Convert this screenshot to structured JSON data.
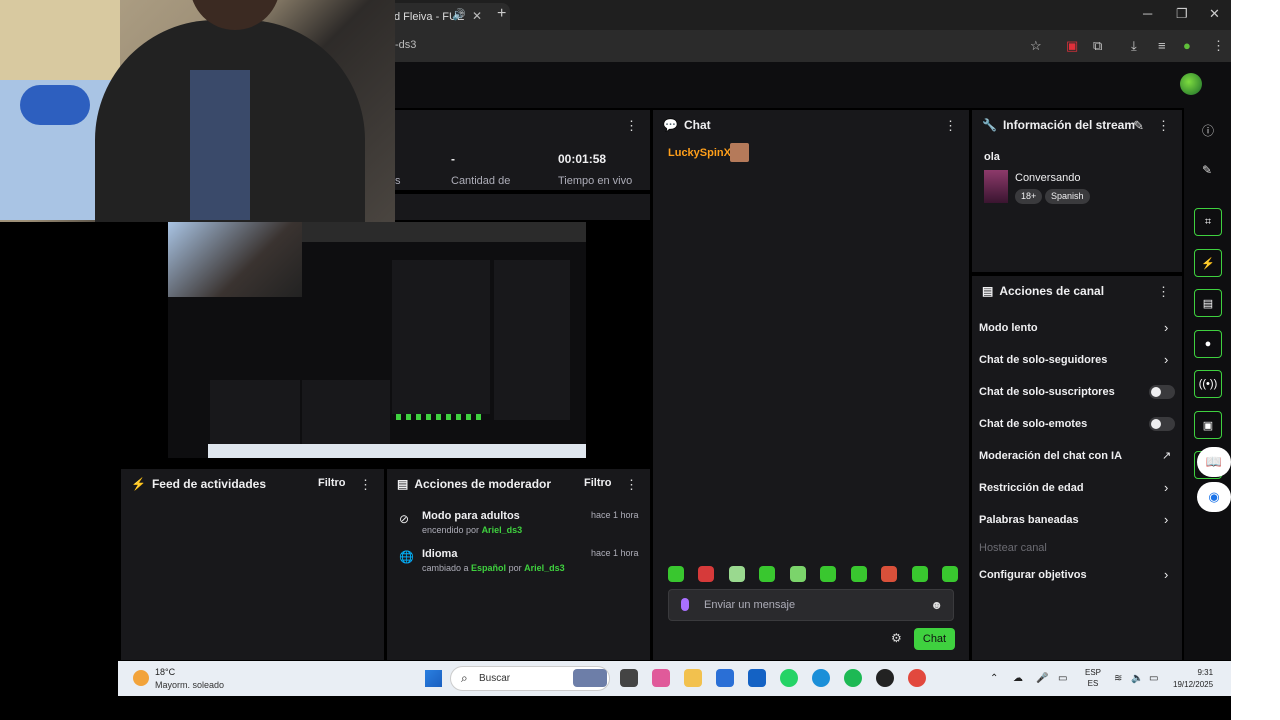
{
  "browser": {
    "tab_title": "d Fleiva - FUE",
    "url": "-ds3"
  },
  "stats": {
    "first_label_fragment": "s",
    "viewers_value": "-",
    "viewers_label": "Cantidad de",
    "uptime_value": "00:01:58",
    "uptime_label": "Tiempo en vivo"
  },
  "chat": {
    "title": "Chat",
    "message_user": "LuckySpinX:",
    "input_placeholder": "Enviar un mensaje",
    "send_label": "Chat",
    "accent_color": "#3fd13f",
    "username_color": "#ff9f1a"
  },
  "stream_info": {
    "title": "Información del stream",
    "stream_title": "ola",
    "category": "Conversando",
    "tags": [
      "18+",
      "Spanish"
    ]
  },
  "channel_actions": {
    "title": "Acciones de canal",
    "items": [
      {
        "label": "Modo lento",
        "control": "chevron"
      },
      {
        "label": "Chat de solo-seguidores",
        "control": "chevron"
      },
      {
        "label": "Chat de solo-suscriptores",
        "control": "toggle"
      },
      {
        "label": "Chat de solo-emotes",
        "control": "toggle"
      },
      {
        "label": "Moderación del chat con IA",
        "control": "external"
      },
      {
        "label": "Restricción de edad",
        "control": "chevron"
      },
      {
        "label": "Palabras baneadas",
        "control": "chevron"
      },
      {
        "label": "Hostear canal",
        "control": "disabled"
      },
      {
        "label": "Configurar objetivos",
        "control": "chevron"
      }
    ]
  },
  "activity_feed": {
    "title": "Feed de actividades",
    "filter_label": "Filtro"
  },
  "mod_actions": {
    "title": "Acciones de moderador",
    "filter_label": "Filtro",
    "items": [
      {
        "title": "Modo para adultos",
        "prefix": "encendido por",
        "user": "Ariel_ds3",
        "time": "hace 1 hora"
      },
      {
        "title": "Idioma",
        "prefix": "cambiado a",
        "value": "Español",
        "middle": "por",
        "user": "Ariel_ds3",
        "time": "hace 1 hora"
      }
    ]
  },
  "taskbar": {
    "temperature": "18°C",
    "weather": "Mayorm. soleado",
    "search_placeholder": "Buscar",
    "lang_top": "ESP",
    "lang_bottom": "ES",
    "time": "9:31",
    "date": "19/12/2025"
  }
}
